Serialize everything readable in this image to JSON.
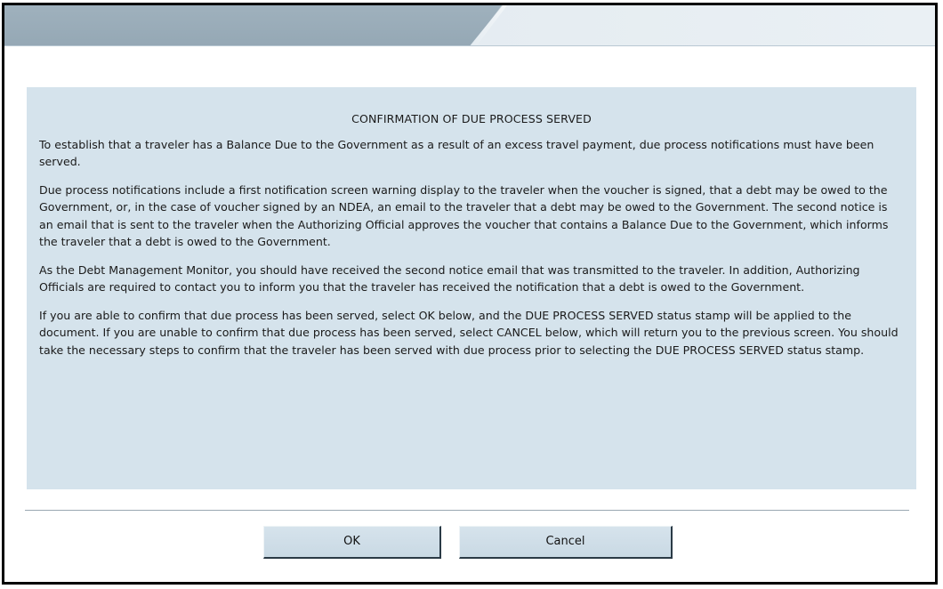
{
  "dialog": {
    "title": "CONFIRMATION OF DUE PROCESS SERVED",
    "paragraphs": [
      "To establish that a traveler has a Balance Due to the Government as a result of an excess travel payment, due process notifications must have been served.",
      "Due process notifications include a first notification screen warning display to the traveler when the voucher is signed, that a debt may be owed to the Government, or, in the case of voucher signed by an NDEA, an email to the traveler that a debt may be owed to the Government. The second notice is an email that is sent to the traveler when the Authorizing Official approves the voucher that contains a Balance Due to the Government, which informs the traveler that a debt is owed to the Government.",
      "As the Debt Management Monitor, you should have received the second notice email that was transmitted to the traveler. In addition, Authorizing Officials are required to contact you to inform you that the traveler has received the notification that a debt is owed to the Government.",
      "If you are able to confirm that due process has been served, select OK below, and the DUE PROCESS SERVED status stamp will be applied to the document. If you are unable to confirm that due process has been served, select CANCEL below, which will return you to the previous screen. You should take the necessary steps to confirm that the traveler has been served with due process prior to selecting the DUE PROCESS SERVED status stamp."
    ]
  },
  "buttons": {
    "ok_label": "OK",
    "cancel_label": "Cancel"
  },
  "colors": {
    "header_tab": "#9fb1bd",
    "header_bar": "#e6edf2",
    "panel_background": "#d5e3ec",
    "button_background": "#cfdde7",
    "border": "#000000"
  }
}
